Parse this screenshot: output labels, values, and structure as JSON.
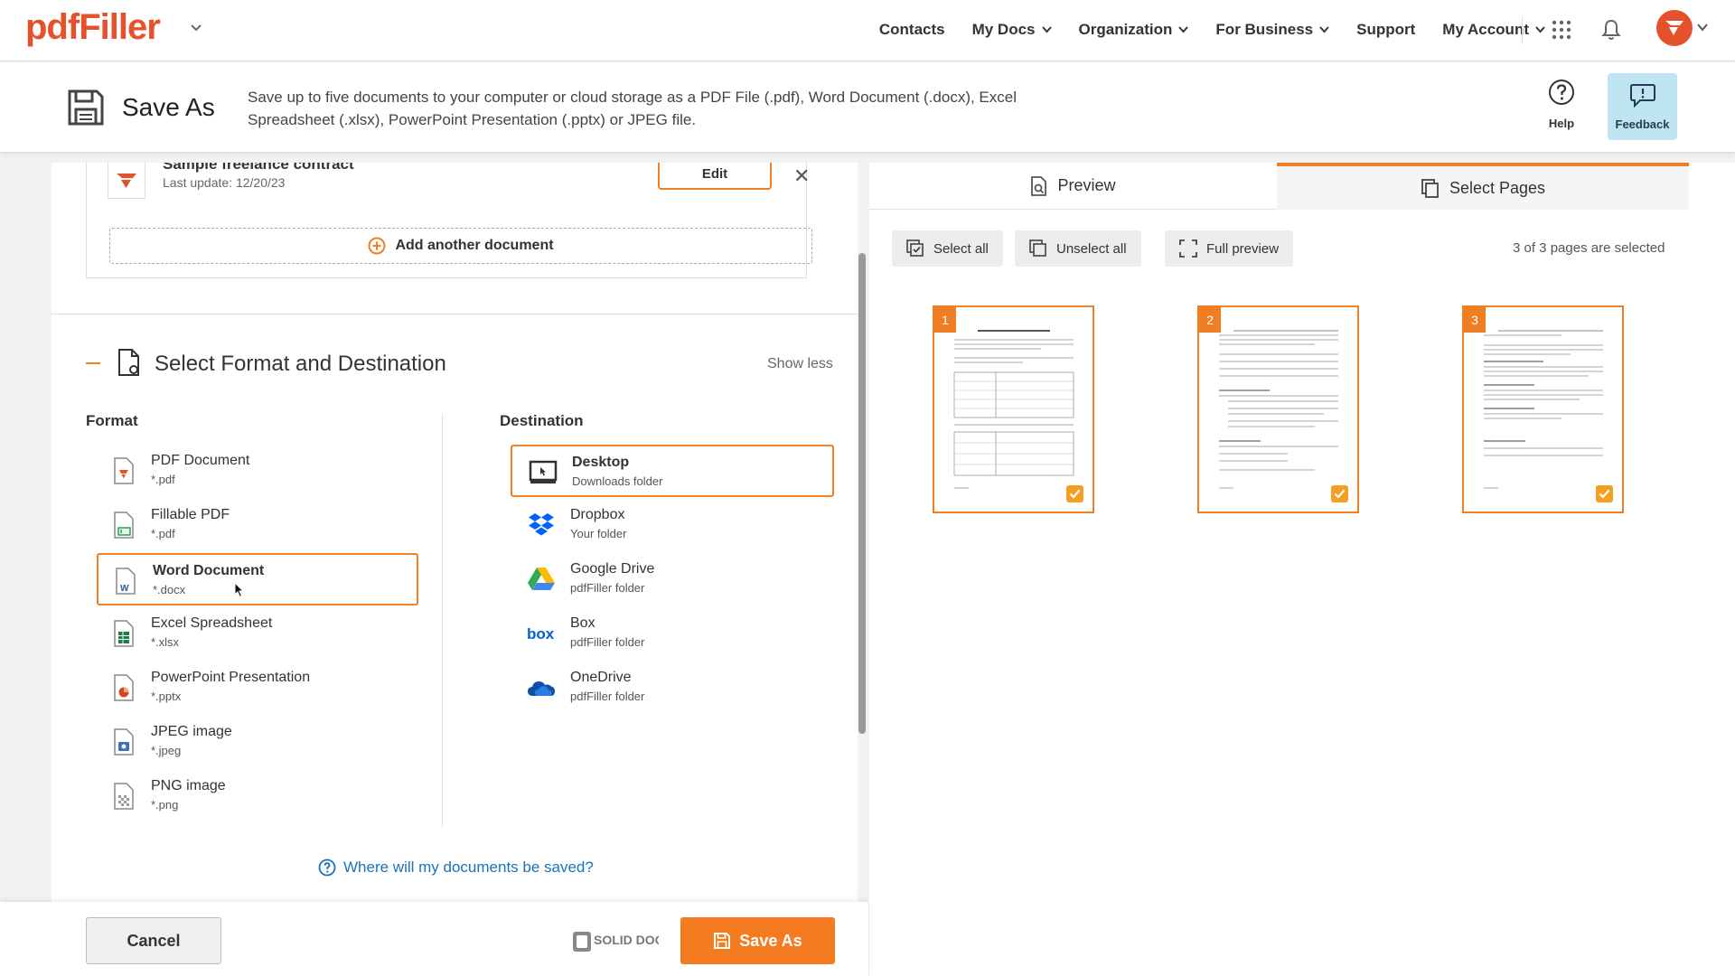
{
  "app": {
    "logo": "pdfFiller"
  },
  "nav": {
    "items": [
      "Contacts",
      "My Docs",
      "Organization",
      "For Business",
      "Support",
      "My Account"
    ]
  },
  "header": {
    "title": "Save As",
    "description": "Save up to five documents to your computer or cloud storage as a PDF File (.pdf), Word Document (.docx), Excel Spreadsheet (.xlsx), PowerPoint Presentation (.pptx) or JPEG file.",
    "help_label": "Help",
    "feedback_label": "Feedback"
  },
  "document": {
    "title": "Sample freelance contract",
    "last_update": "Last update: 12/20/23",
    "edit_label": "Edit",
    "add_another": "Add another document"
  },
  "section": {
    "title": "Select Format and Destination",
    "toggle": "Show less"
  },
  "format": {
    "label": "Format",
    "items": [
      {
        "label": "PDF Document",
        "ext": "*.pdf"
      },
      {
        "label": "Fillable PDF",
        "ext": "*.pdf"
      },
      {
        "label": "Word Document",
        "ext": "*.docx"
      },
      {
        "label": "Excel Spreadsheet",
        "ext": "*.xlsx"
      },
      {
        "label": "PowerPoint Presentation",
        "ext": "*.pptx"
      },
      {
        "label": "JPEG image",
        "ext": "*.jpeg"
      },
      {
        "label": "PNG image",
        "ext": "*.png"
      }
    ],
    "selected_index": 2
  },
  "destination": {
    "label": "Destination",
    "items": [
      {
        "label": "Desktop",
        "sub": "Downloads folder"
      },
      {
        "label": "Dropbox",
        "sub": "Your folder"
      },
      {
        "label": "Google Drive",
        "sub": "pdfFiller folder"
      },
      {
        "label": "Box",
        "sub": "pdfFiller folder"
      },
      {
        "label": "OneDrive",
        "sub": "pdfFiller folder"
      }
    ],
    "selected_index": 0
  },
  "where_link": "Where will my documents be saved?",
  "footer": {
    "cancel": "Cancel",
    "save_as": "Save As",
    "partner_logo": "SOLID DOCUMENTS"
  },
  "preview": {
    "tabs": [
      "Preview",
      "Select Pages"
    ],
    "active_tab": "Select Pages",
    "select_all": "Select all",
    "unselect_all": "Unselect all",
    "full_preview": "Full preview",
    "pages_selected": "3 of 3 pages are selected",
    "pages": [
      {
        "number": "1",
        "checked": true
      },
      {
        "number": "2",
        "checked": true
      },
      {
        "number": "3",
        "checked": true
      }
    ]
  },
  "colors": {
    "accent": "#f07f23",
    "brand": "#e5512a",
    "link": "#1a73b8",
    "feedback_bg": "#bfe4f2"
  }
}
